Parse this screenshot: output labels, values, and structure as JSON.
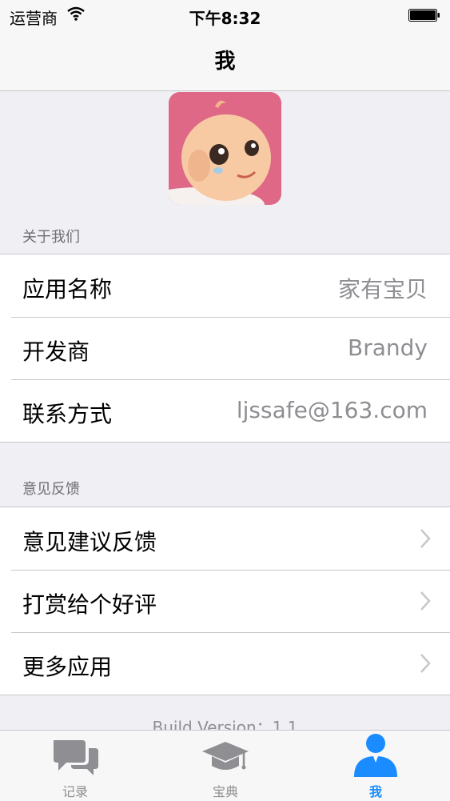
{
  "status_bar": {
    "carrier": "运营商",
    "time": "下午8:32"
  },
  "nav": {
    "title": "我"
  },
  "about": {
    "header": "关于我们",
    "rows": [
      {
        "label": "应用名称",
        "value": "家有宝贝"
      },
      {
        "label": "开发商",
        "value": "Brandy"
      },
      {
        "label": "联系方式",
        "value": "ljssafe@163.com"
      }
    ]
  },
  "feedback": {
    "header": "意见反馈",
    "rows": [
      {
        "label": "意见建议反馈"
      },
      {
        "label": "打赏给个好评"
      },
      {
        "label": "更多应用"
      }
    ]
  },
  "build_version": "Build Version：1.1",
  "tabs": [
    {
      "label": "记录",
      "icon": "chat-bubbles-icon"
    },
    {
      "label": "宝典",
      "icon": "graduation-cap-icon"
    },
    {
      "label": "我",
      "icon": "person-icon",
      "active": true
    }
  ],
  "colors": {
    "accent": "#1a8cff",
    "logo_bg": "#d9607f"
  }
}
